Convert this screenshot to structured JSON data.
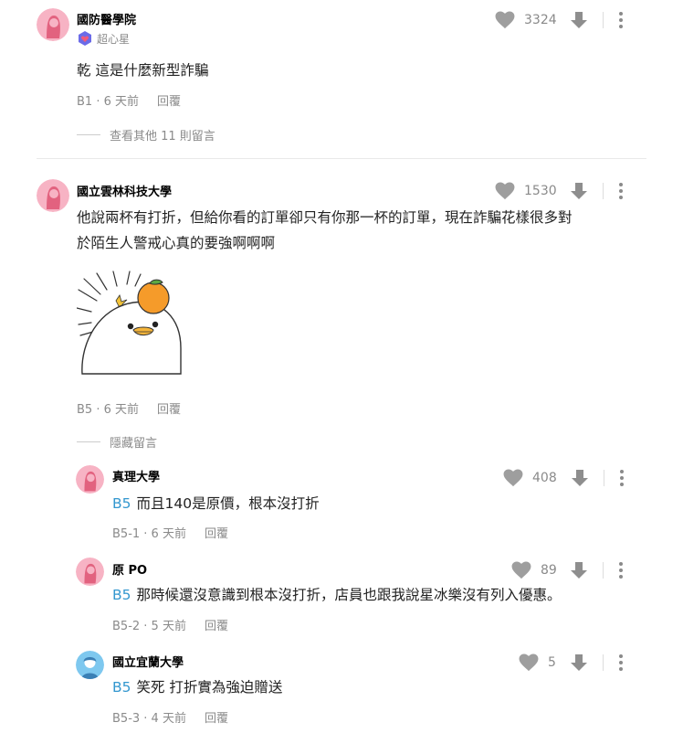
{
  "comments": [
    {
      "author": "國防醫學院",
      "badge": "超心星",
      "text": "乾 這是什麼新型詐騙",
      "floor": "B1 · 6 天前",
      "reply_label": "回覆",
      "likes": "3324",
      "more_replies": "查看其他 11 則留言"
    },
    {
      "author": "國立雲林科技大學",
      "text_lines": [
        "他說兩杯有打折，但給你看的訂單卻只有你那一杯的訂單，現在詐騙花樣很多對",
        "於陌生人警戒心真的要強啊啊啊"
      ],
      "floor": "B5 · 6 天前",
      "reply_label": "回覆",
      "likes": "1530",
      "hide_replies": "隱藏留言"
    }
  ],
  "replies": [
    {
      "author": "真理大學",
      "tag": "B5",
      "text": "而且140是原價，根本沒打折",
      "floor": "B5-1 · 6 天前",
      "reply_label": "回覆",
      "likes": "408"
    },
    {
      "author": "原 PO",
      "tag": "B5",
      "text": "那時候還沒意識到根本沒打折，店員也跟我說星冰樂沒有列入優惠。",
      "floor": "B5-2 · 5 天前",
      "reply_label": "回覆",
      "likes": "89"
    },
    {
      "author": "國立宜蘭大學",
      "tag": "B5",
      "text": "笑死 打折實為強迫贈送",
      "floor": "B5-3 · 4 天前",
      "reply_label": "回覆",
      "likes": "5"
    }
  ],
  "colors": {
    "female_avatar": "#f7b3c4",
    "male_avatar": "#7ec8ef",
    "tag": "#3397cf",
    "muted": "#8a8a8a"
  }
}
